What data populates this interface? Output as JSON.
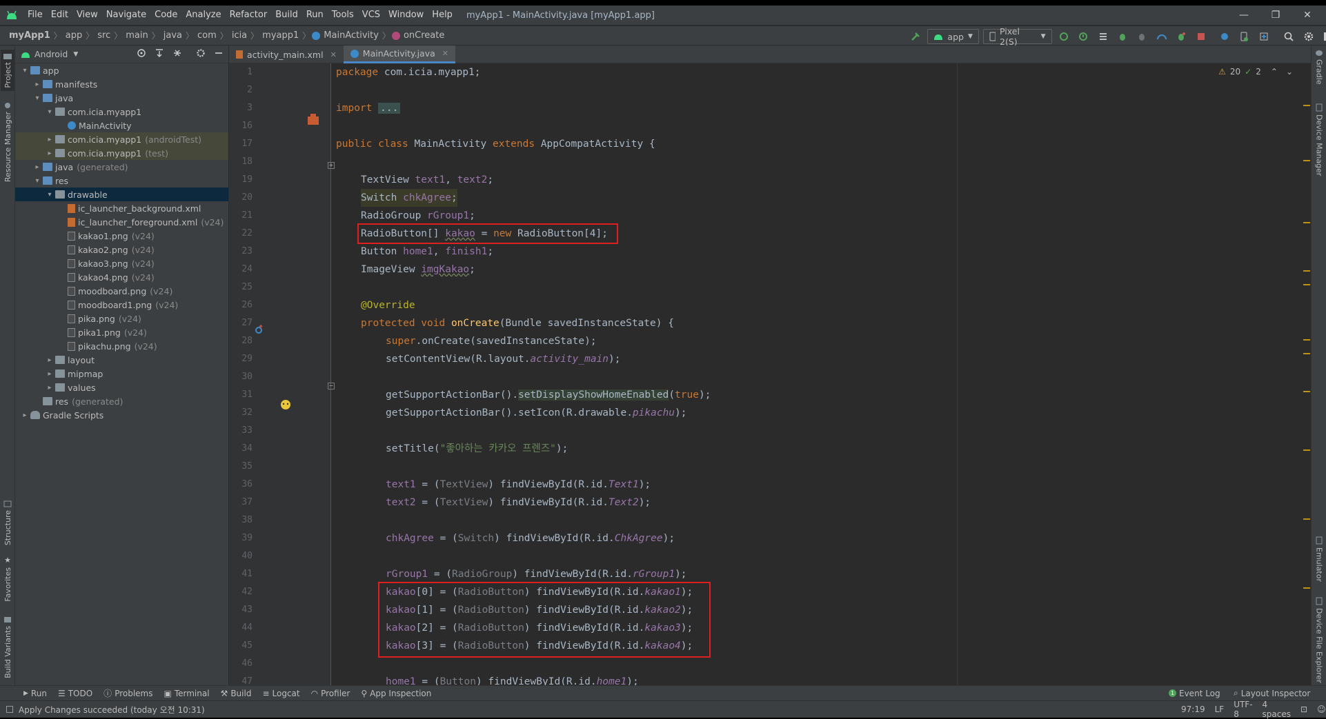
{
  "window": {
    "title": "myApp1 - MainActivity.java [myApp1.app]",
    "menu": [
      "File",
      "Edit",
      "View",
      "Navigate",
      "Code",
      "Analyze",
      "Refactor",
      "Build",
      "Run",
      "Tools",
      "VCS",
      "Window",
      "Help"
    ]
  },
  "breadcrumb": [
    "myApp1",
    "app",
    "src",
    "main",
    "java",
    "com",
    "icia",
    "myapp1",
    "MainActivity",
    "onCreate"
  ],
  "toolbar": {
    "run_config": "app",
    "device": "Pixel 2(S)"
  },
  "project_panel": {
    "view_mode": "Android",
    "tree": [
      {
        "label": "app",
        "hint": "",
        "depth": 0,
        "arrow": "▾",
        "icon": "folder-blue"
      },
      {
        "label": "manifests",
        "hint": "",
        "depth": 1,
        "arrow": "▸",
        "icon": "folder-blue"
      },
      {
        "label": "java",
        "hint": "",
        "depth": 1,
        "arrow": "▾",
        "icon": "folder-blue"
      },
      {
        "label": "com.icia.myapp1",
        "hint": "",
        "depth": 2,
        "arrow": "▾",
        "icon": "folder"
      },
      {
        "label": "MainActivity",
        "hint": "",
        "depth": 3,
        "arrow": "",
        "icon": "class"
      },
      {
        "label": "com.icia.myapp1",
        "hint": "(androidTest)",
        "depth": 2,
        "arrow": "▸",
        "icon": "folder",
        "style": "olive"
      },
      {
        "label": "com.icia.myapp1",
        "hint": "(test)",
        "depth": 2,
        "arrow": "▸",
        "icon": "folder",
        "style": "olive"
      },
      {
        "label": "java",
        "hint": "(generated)",
        "depth": 1,
        "arrow": "▸",
        "icon": "folder-blue"
      },
      {
        "label": "res",
        "hint": "",
        "depth": 1,
        "arrow": "▾",
        "icon": "folder-blue"
      },
      {
        "label": "drawable",
        "hint": "",
        "depth": 2,
        "arrow": "▾",
        "icon": "folder",
        "style": "selected"
      },
      {
        "label": "ic_launcher_background.xml",
        "hint": "",
        "depth": 3,
        "arrow": "",
        "icon": "xml"
      },
      {
        "label": "ic_launcher_foreground.xml",
        "hint": "(v24)",
        "depth": 3,
        "arrow": "",
        "icon": "xml"
      },
      {
        "label": "kakao1.png",
        "hint": "(v24)",
        "depth": 3,
        "arrow": "",
        "icon": "png"
      },
      {
        "label": "kakao2.png",
        "hint": "(v24)",
        "depth": 3,
        "arrow": "",
        "icon": "png"
      },
      {
        "label": "kakao3.png",
        "hint": "(v24)",
        "depth": 3,
        "arrow": "",
        "icon": "png"
      },
      {
        "label": "kakao4.png",
        "hint": "(v24)",
        "depth": 3,
        "arrow": "",
        "icon": "png"
      },
      {
        "label": "moodboard.png",
        "hint": "(v24)",
        "depth": 3,
        "arrow": "",
        "icon": "png"
      },
      {
        "label": "moodboard1.png",
        "hint": "(v24)",
        "depth": 3,
        "arrow": "",
        "icon": "png"
      },
      {
        "label": "pika.png",
        "hint": "(v24)",
        "depth": 3,
        "arrow": "",
        "icon": "png"
      },
      {
        "label": "pika1.png",
        "hint": "(v24)",
        "depth": 3,
        "arrow": "",
        "icon": "png"
      },
      {
        "label": "pikachu.png",
        "hint": "(v24)",
        "depth": 3,
        "arrow": "",
        "icon": "png"
      },
      {
        "label": "layout",
        "hint": "",
        "depth": 2,
        "arrow": "▸",
        "icon": "folder"
      },
      {
        "label": "mipmap",
        "hint": "",
        "depth": 2,
        "arrow": "▸",
        "icon": "folder"
      },
      {
        "label": "values",
        "hint": "",
        "depth": 2,
        "arrow": "▸",
        "icon": "folder"
      },
      {
        "label": "res",
        "hint": "(generated)",
        "depth": 1,
        "arrow": "",
        "icon": "folder"
      },
      {
        "label": "Gradle Scripts",
        "hint": "",
        "depth": 0,
        "arrow": "▸",
        "icon": "gradle"
      }
    ]
  },
  "left_stripe_tabs": [
    "Project",
    "Resource Manager",
    "Structure",
    "Favorites",
    "Build Variants"
  ],
  "right_stripe_tabs": [
    "Gradle",
    "Device Manager",
    "Emulator",
    "Device File Explorer"
  ],
  "editor_tabs": [
    {
      "label": "activity_main.xml",
      "active": false
    },
    {
      "label": "MainActivity.java",
      "active": true
    }
  ],
  "inspections": {
    "warnings": "20",
    "weak_warnings": "2"
  },
  "code": {
    "line_numbers": [
      "1",
      "2",
      "3",
      "16",
      "17",
      "18",
      "19",
      "20",
      "21",
      "22",
      "23",
      "24",
      "25",
      "26",
      "27",
      "28",
      "29",
      "30",
      "31",
      "32",
      "33",
      "34",
      "35",
      "36",
      "37",
      "38",
      "39",
      "40",
      "41",
      "42",
      "43",
      "44",
      "45",
      "46",
      "47"
    ],
    "l1_kw": "package",
    "l1_rest": " com.icia.myapp1;",
    "l3_kw": "import",
    "l3_fold": "...",
    "l17_kw1": "public class",
    "l17_name": " MainActivity ",
    "l17_kw2": "extends",
    "l17_rest": " AppCompatActivity {",
    "l19_type": "TextView ",
    "l19_f1": "text1",
    "l19_sep": ", ",
    "l19_f2": "text2",
    "l19_end": ";",
    "l20_type": "Switch ",
    "l20_f": "chkAgree",
    "l20_end": ";",
    "l21_type": "RadioGroup ",
    "l21_f": "rGroup1",
    "l21_end": ";",
    "l22_type": "RadioButton[] ",
    "l22_f": "kakao",
    "l22_eq": " = ",
    "l22_kw": "new",
    "l22_rest": " RadioButton[4];",
    "l23_type": "Button ",
    "l23_f1": "home1",
    "l23_sep": ", ",
    "l23_f2": "finish1",
    "l23_end": ";",
    "l24_type": "ImageView ",
    "l24_f": "imgKakao",
    "l24_end": ";",
    "l26_ann": "@Override",
    "l27_kw": "protected void ",
    "l27_m": "onCreate",
    "l27_rest": "(Bundle savedInstanceState) {",
    "l28_kw": "super",
    "l28_rest": ".onCreate(savedInstanceState);",
    "l29_a": "setContentView(R.layout.",
    "l29_i": "activity_main",
    "l29_b": ");",
    "l31_a": "getSupportActionBar().",
    "l31_m": "setDisplayShowHomeEnabled",
    "l31_b": "(",
    "l31_kw": "true",
    "l31_c": ");",
    "l32_a": "getSupportActionBar().setIcon(R.drawable.",
    "l32_i": "pikachu",
    "l32_b": ");",
    "l34_a": "setTitle(",
    "l34_s": "\"좋아하는 카카오 프렌즈\"",
    "l34_b": ");",
    "l36_f": "text1",
    "l36_a": " = (",
    "l36_c": "TextView",
    "l36_b": ") findViewById(R.id.",
    "l36_i": "Text1",
    "l36_e": ");",
    "l37_f": "text2",
    "l37_a": " = (",
    "l37_c": "TextView",
    "l37_b": ") findViewById(R.id.",
    "l37_i": "Text2",
    "l37_e": ");",
    "l39_f": "chkAgree",
    "l39_a": " = (",
    "l39_c": "Switch",
    "l39_b": ") findViewById(R.id.",
    "l39_i": "ChkAgree",
    "l39_e": ");",
    "l41_f": "rGroup1",
    "l41_a": " = (",
    "l41_c": "RadioGroup",
    "l41_b": ") findViewById(R.id.",
    "l41_i": "rGroup1",
    "l41_e": ");",
    "l42_f": "kakao",
    "l42_a": "[0] = (",
    "l42_c": "RadioButton",
    "l42_b": ") findViewById(R.id.",
    "l42_i": "kakao1",
    "l42_e": ");",
    "l43_f": "kakao",
    "l43_a": "[1] = (",
    "l43_c": "RadioButton",
    "l43_b": ") findViewById(R.id.",
    "l43_i": "kakao2",
    "l43_e": ");",
    "l44_f": "kakao",
    "l44_a": "[2] = (",
    "l44_c": "RadioButton",
    "l44_b": ") findViewById(R.id.",
    "l44_i": "kakao3",
    "l44_e": ");",
    "l45_f": "kakao",
    "l45_a": "[3] = (",
    "l45_c": "RadioButton",
    "l45_b": ") findViewById(R.id.",
    "l45_i": "kakao4",
    "l45_e": ");",
    "l47_f": "home1",
    "l47_a": " = (",
    "l47_c": "Button",
    "l47_b": ") findViewById(R.id.",
    "l47_i": "home1",
    "l47_e": ");"
  },
  "bottom_tools": {
    "run": "Run",
    "todo": "TODO",
    "problems": "Problems",
    "terminal": "Terminal",
    "build": "Build",
    "logcat": "Logcat",
    "profiler": "Profiler",
    "app_inspection": "App Inspection",
    "event_log": "Event Log",
    "layout_inspector": "Layout Inspector"
  },
  "status": {
    "message": "Apply Changes succeeded (today 오전 10:31)",
    "position": "97:19",
    "line_sep": "LF",
    "encoding": "UTF-8",
    "indent": "4 spaces"
  },
  "colors": {
    "keyword": "#cc7832",
    "field": "#9876aa",
    "method": "#ffc66d",
    "annotation": "#bbb529",
    "string": "#6a8759",
    "highlight_box": "#e02020"
  }
}
